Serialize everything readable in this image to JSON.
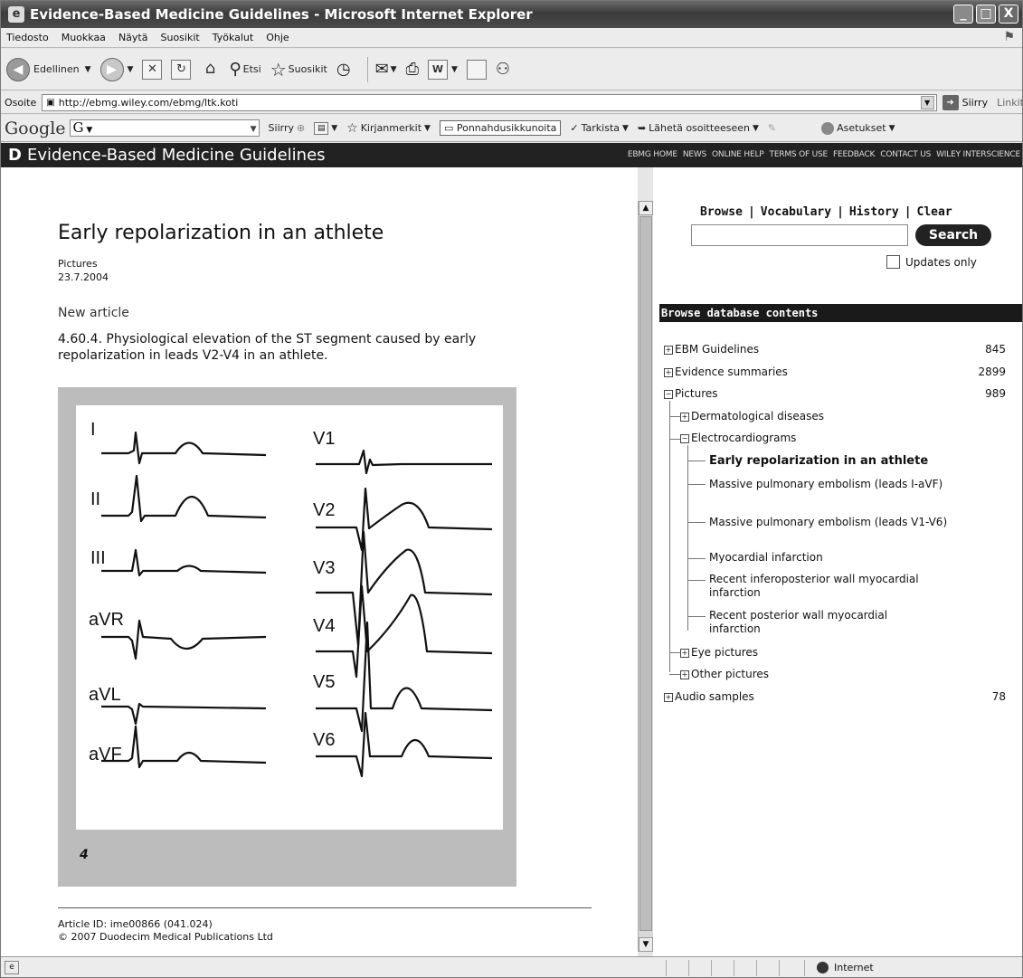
{
  "window": {
    "title": "Evidence-Based Medicine Guidelines - Microsoft Internet Explorer",
    "buttons": {
      "minimize": "_",
      "maximize": "□",
      "close": "X"
    }
  },
  "menu": [
    "Tiedosto",
    "Muokkaa",
    "Näytä",
    "Suosikit",
    "Työkalut",
    "Ohje"
  ],
  "toolbar": {
    "back_label": "Edellinen",
    "search_label": "Etsi",
    "favorites_label": "Suosikit"
  },
  "address": {
    "label": "Osoite",
    "url": "http://ebmg.wiley.com/ebmg/ltk.koti",
    "go_label": "Siirry",
    "links_label": "Linkit"
  },
  "google_bar": {
    "logo": "Google",
    "field": "G",
    "go_label": "Siirry",
    "bookmarks_label": "Kirjanmerkit",
    "popups_label": "Ponnahdusikkunoita",
    "check_label": "Tarkista",
    "send_label": "Lähetä osoitteeseen",
    "settings_label": "Asetukset"
  },
  "site": {
    "logo": "D",
    "name": "Evidence-Based Medicine Guidelines",
    "nav": [
      "EBMG HOME",
      "NEWS",
      "ONLINE HELP",
      "TERMS OF USE",
      "FEEDBACK",
      "CONTACT US",
      "WILEY INTERSCIENCE"
    ]
  },
  "article": {
    "title": "Early repolarization in an athlete",
    "category": "Pictures",
    "date": "23.7.2004",
    "status": "New article",
    "caption": "4.60.4. Physiological elevation of the ST segment caused by early repolarization in leads V2-V4 in an athlete.",
    "figure_number": "4",
    "article_id": "Article ID: ime00866 (041.024)",
    "copyright": "© 2007 Duodecim Medical Publications Ltd"
  },
  "ecg_leads": {
    "left": [
      "I",
      "II",
      "III",
      "aVR",
      "aVL",
      "aVF"
    ],
    "right": [
      "V1",
      "V2",
      "V3",
      "V4",
      "V5",
      "V6"
    ]
  },
  "sidebar": {
    "links": [
      "Browse",
      "Vocabulary",
      "History",
      "Clear"
    ],
    "search_button": "Search",
    "search_value": "",
    "updates_only": "Updates only",
    "header": "Browse database contents",
    "top_items": [
      {
        "label": "EBM Guidelines",
        "count": "845"
      },
      {
        "label": "Evidence summaries",
        "count": "2899"
      },
      {
        "label": "Pictures",
        "count": "989"
      },
      {
        "label": "Audio samples",
        "count": "78"
      }
    ],
    "sub_items": [
      "Dermatological diseases",
      "Electrocardiograms",
      "Eye pictures",
      "Other pictures"
    ],
    "ecg_items": [
      "Early repolarization in an athlete",
      "Massive pulmonary embolism (leads I-aVF)",
      "Massive pulmonary embolism (leads V1-V6)",
      "Myocardial infarction",
      "Recent inferoposterior wall myocardial infarction",
      "Recent posterior wall myocardial infarction"
    ]
  },
  "statusbar": {
    "zone": "Internet"
  }
}
